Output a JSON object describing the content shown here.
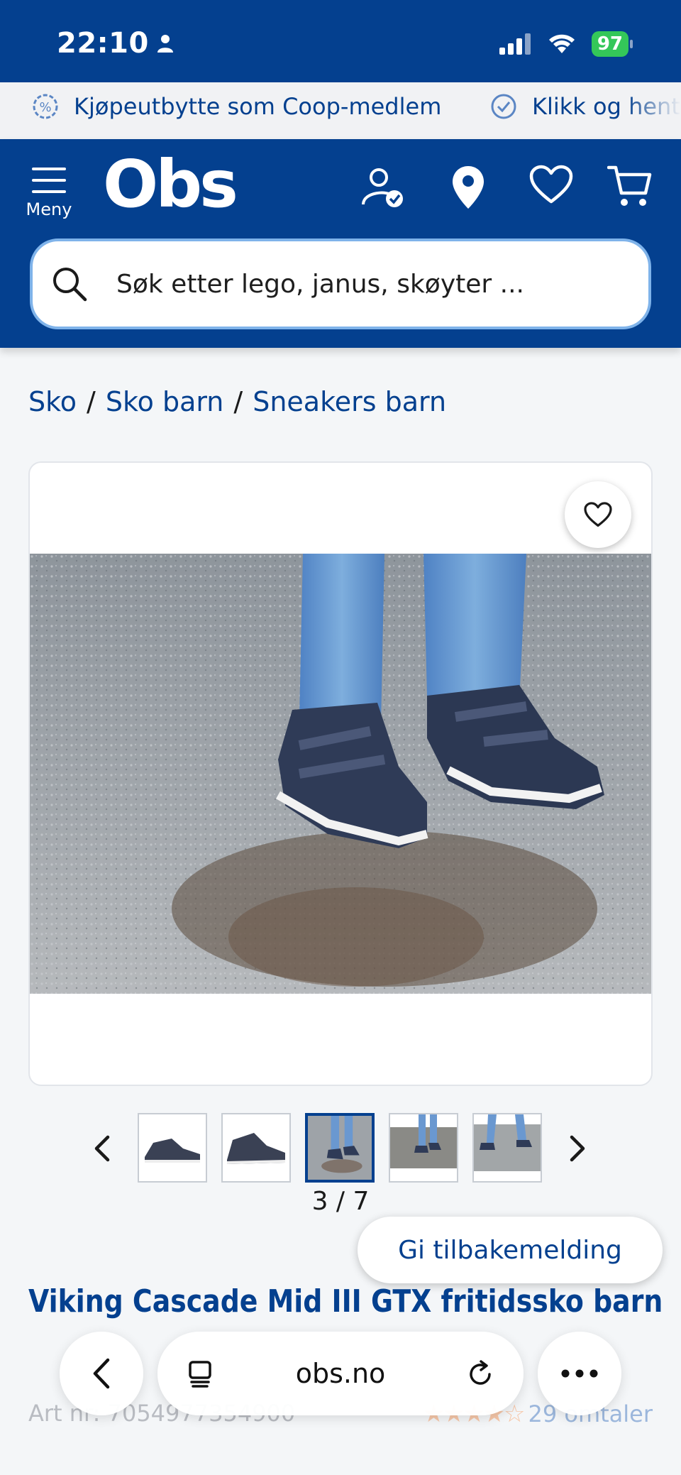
{
  "status_bar": {
    "time": "22:10",
    "battery": "97"
  },
  "promo": {
    "items": [
      {
        "label": "Kjøpeutbytte som Coop-medlem",
        "icon": "percent-badge-icon"
      },
      {
        "label": "Klikk og hent",
        "icon": "check-circle-icon"
      }
    ]
  },
  "header": {
    "menu_label": "Meny",
    "logo": "Obs",
    "search_placeholder": "Søk etter lego, janus, skøyter ..."
  },
  "breadcrumb": [
    "Sko",
    "Sko barn",
    "Sneakers barn"
  ],
  "gallery": {
    "counter": "3 / 7",
    "current": 3,
    "total": 7
  },
  "feedback_label": "Gi tilbakemelding",
  "product": {
    "title": "Viking Cascade Mid III GTX fritidssko barn",
    "art_nr": "Art nr: 7054977354900",
    "rating_stars": "★★★★☆",
    "rating_value": 4.5,
    "reviews": "29 omtaler"
  },
  "browser": {
    "url": "obs.no"
  },
  "colors": {
    "brand_blue": "#04408f",
    "search_border": "#7fb3ea",
    "battery_green": "#34c759"
  }
}
